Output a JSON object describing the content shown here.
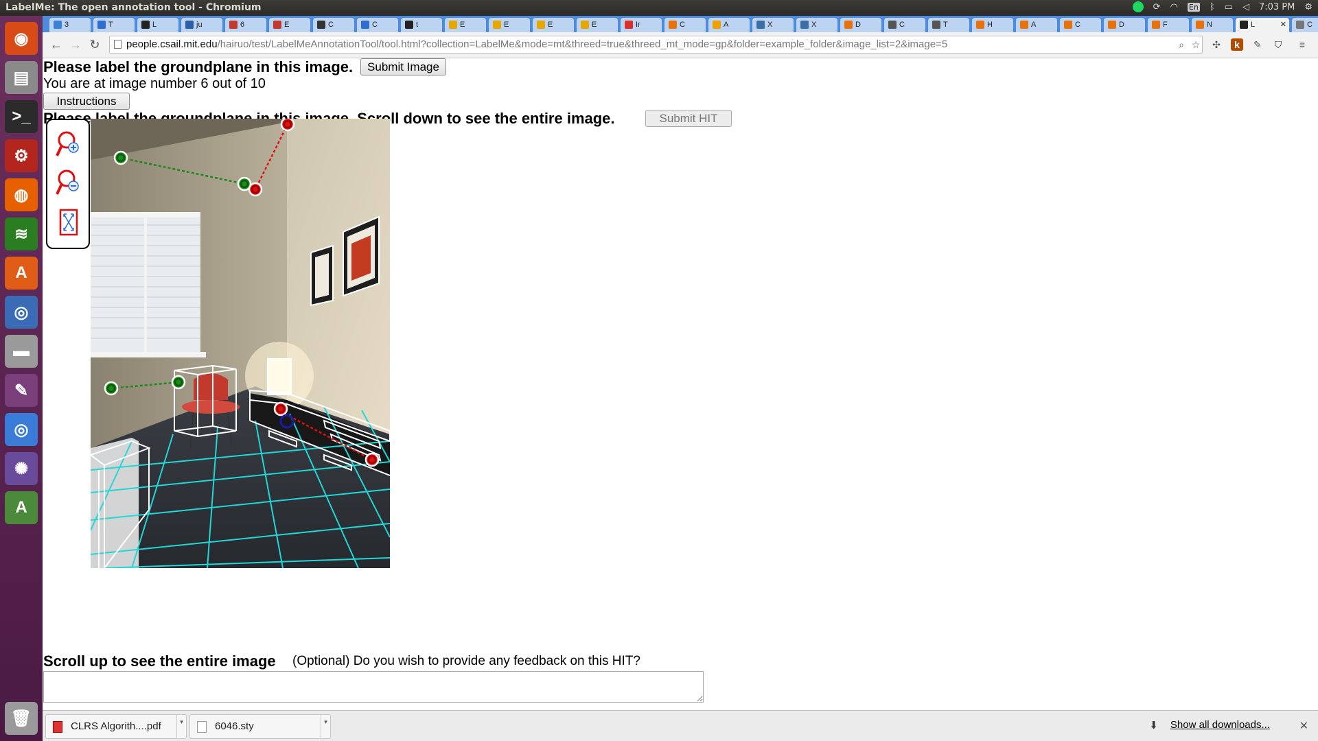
{
  "window": {
    "title": "LabelMe: The open annotation tool - Chromium"
  },
  "system_tray": {
    "keyboard": "En",
    "time": "7:03 PM"
  },
  "launcher": [
    {
      "name": "ubuntu-dash-icon",
      "color": "#d84b16"
    },
    {
      "name": "files-icon",
      "color": "#8a8a8a"
    },
    {
      "name": "terminal-icon",
      "color": "#2b2b2b"
    },
    {
      "name": "system-settings-icon",
      "color": "#b3261e"
    },
    {
      "name": "firefox-icon",
      "color": "#e66000"
    },
    {
      "name": "spotify-icon",
      "color": "#2a7d20"
    },
    {
      "name": "software-center-icon",
      "color": "#e05d18"
    },
    {
      "name": "app-icon",
      "color": "#3a6bb5"
    },
    {
      "name": "disk-icon",
      "color": "#9a9a9a"
    },
    {
      "name": "texmaker-icon",
      "color": "#7a3f7a"
    },
    {
      "name": "chromium-icon",
      "color": "#3b7bd8"
    },
    {
      "name": "shotwell-icon",
      "color": "#6a4a9a"
    },
    {
      "name": "update-manager-icon",
      "color": "#4a8a3a"
    },
    {
      "name": "trash-icon",
      "color": "#9a9a9a"
    }
  ],
  "tabs": [
    {
      "label": "3",
      "color": "#3b82d6"
    },
    {
      "label": "T",
      "color": "#2d6ed0"
    },
    {
      "label": "L",
      "color": "#222222"
    },
    {
      "label": "ju",
      "color": "#2a5fa8"
    },
    {
      "label": "6",
      "color": "#c0392b"
    },
    {
      "label": "E",
      "color": "#c0392b"
    },
    {
      "label": "C",
      "color": "#333333"
    },
    {
      "label": "C",
      "color": "#2d6ed0"
    },
    {
      "label": "t",
      "color": "#222222"
    },
    {
      "label": "E",
      "color": "#e6a700"
    },
    {
      "label": "E",
      "color": "#e6a700"
    },
    {
      "label": "E",
      "color": "#e6a700"
    },
    {
      "label": "E",
      "color": "#e6a700"
    },
    {
      "label": "Ir",
      "color": "#d93025"
    },
    {
      "label": "C",
      "color": "#e8710a"
    },
    {
      "label": "A",
      "color": "#f0a000"
    },
    {
      "label": "X",
      "color": "#3b6ea5"
    },
    {
      "label": "X",
      "color": "#3b6ea5"
    },
    {
      "label": "D",
      "color": "#e8710a"
    },
    {
      "label": "C",
      "color": "#555555"
    },
    {
      "label": "T",
      "color": "#555555"
    },
    {
      "label": "H",
      "color": "#e8710a"
    },
    {
      "label": "A",
      "color": "#e8710a"
    },
    {
      "label": "C",
      "color": "#e8710a"
    },
    {
      "label": "D",
      "color": "#e8710a"
    },
    {
      "label": "F",
      "color": "#e8710a"
    },
    {
      "label": "N",
      "color": "#e8710a"
    },
    {
      "label": "L",
      "color": "#222222",
      "active": true
    },
    {
      "label": "C",
      "color": "#777777"
    }
  ],
  "address_bar": {
    "host": "people.csail.mit.edu",
    "path": "/hairuo/test/LabelMeAnnotationTool/tool.html?collection=LabelMe&mode=mt&threed=true&threed_mt_mode=gp&folder=example_folder&image_list=2&image=5"
  },
  "page": {
    "heading": "Please label the groundplane in this image.",
    "submit_image": "Submit Image",
    "progress": "You are at image number 6 out of 10",
    "instructions": "Instructions",
    "heading2": "Please label the groundplane in this image. Scroll down to see the entire image.",
    "submit_hit": "Submit HIT",
    "scroll_up": "Scroll up to see the entire image",
    "feedback_prompt": "(Optional) Do you wish to provide any feedback on this HIT?",
    "feedback_value": ""
  },
  "tools": [
    {
      "name": "zoom-in-icon"
    },
    {
      "name": "zoom-out-icon"
    },
    {
      "name": "fit-to-screen-icon"
    }
  ],
  "downloads": {
    "items": [
      {
        "label": "CLRS Algorith....pdf",
        "type": "pdf"
      },
      {
        "label": "6046.sty",
        "type": "file"
      }
    ],
    "show_all": "Show all downloads..."
  },
  "colors": {
    "vanishing_line_green": "#1a8a1a",
    "vanishing_line_red": "#e01010",
    "grid_cyan": "#20d8d8",
    "box_white": "#ffffff",
    "point_blue": "#1a1aa8"
  }
}
